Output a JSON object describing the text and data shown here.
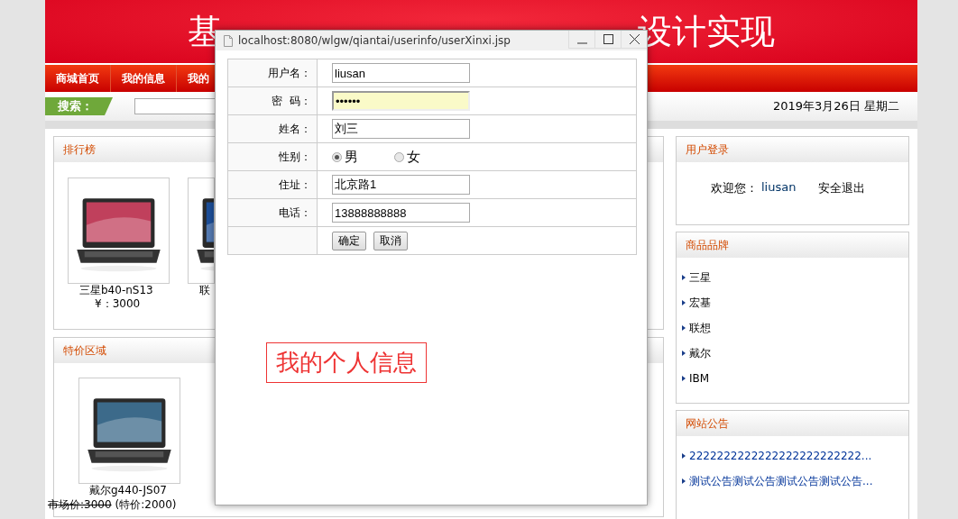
{
  "banner": {
    "title_left": "基",
    "title_right": "设计实现"
  },
  "nav": [
    "商城首页",
    "我的信息",
    "我的"
  ],
  "search": {
    "label": "搜索："
  },
  "date": "2019年3月26日 星期二",
  "ranking": {
    "title": "排行榜",
    "products": [
      {
        "name": "三星b40-nS13",
        "price": "¥：3000"
      },
      {
        "name": "联"
      }
    ]
  },
  "specials": {
    "title": "特价区域",
    "products": [
      {
        "name": "戴尔g440-JS07",
        "market_price": "市场价:3000",
        "special_price": "(特价:2000)"
      }
    ]
  },
  "login": {
    "title": "用户登录",
    "welcome": "欢迎您：",
    "user": "liusan",
    "logout": "安全退出"
  },
  "brands": {
    "title": "商品品牌",
    "items": [
      "三星",
      "宏基",
      "联想",
      "戴尔",
      "IBM"
    ]
  },
  "notices": {
    "title": "网站公告",
    "items": [
      "2222222222222222222222222...",
      "测试公告测试公告测试公告测试公告..."
    ]
  },
  "popup": {
    "title": "localhost:8080/wlgw/qiantai/userinfo/userXinxi.jsp",
    "fields": [
      {
        "label": "用户名：",
        "kind": "text",
        "value": "liusan",
        "focused": false
      },
      {
        "label": "密  码：",
        "kind": "text",
        "value": "••••••",
        "focused": true
      },
      {
        "label": "姓名：",
        "kind": "text",
        "value": "刘三",
        "focused": false
      },
      {
        "label": "性别：",
        "kind": "radio",
        "options": [
          {
            "label": "男",
            "selected": true
          },
          {
            "label": "女",
            "selected": false
          }
        ]
      },
      {
        "label": "住址：",
        "kind": "text",
        "value": "北京路1",
        "focused": false
      },
      {
        "label": "电话：",
        "kind": "text",
        "value": "13888888888",
        "focused": false
      }
    ],
    "buttons": [
      "确定",
      "取消"
    ],
    "heading": "我的个人信息"
  }
}
